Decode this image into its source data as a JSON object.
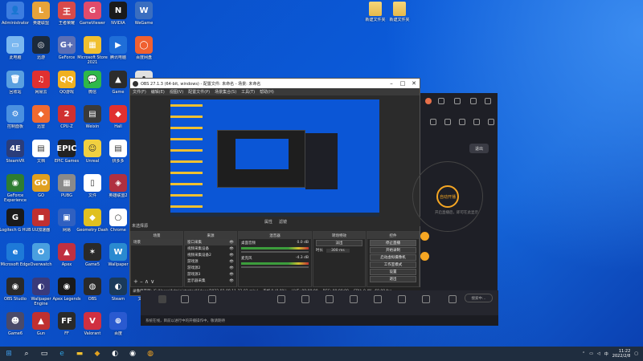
{
  "desktop_icons": [
    {
      "label": "Administrator",
      "color": "#3c7de0",
      "glyph": "👤"
    },
    {
      "label": "英雄联盟",
      "color": "#e8a33a",
      "glyph": "L"
    },
    {
      "label": "王者荣耀",
      "color": "#d84a4a",
      "glyph": "王"
    },
    {
      "label": "GameViewer",
      "color": "#e14b6b",
      "glyph": "G"
    },
    {
      "label": "NVIDIA",
      "color": "#1a1a1a",
      "glyph": "N"
    },
    {
      "label": "WeGame",
      "color": "#3a6ec0",
      "glyph": "W"
    },
    {
      "label": "此电脑",
      "color": "#7ab7f0",
      "glyph": "▭"
    },
    {
      "label": "迅游",
      "color": "#1c2a3b",
      "glyph": "◎"
    },
    {
      "label": "GeForce",
      "color": "#5b6fb5",
      "glyph": "G+"
    },
    {
      "label": "Microsoft Store 2021",
      "color": "#f0c030",
      "glyph": "▦"
    },
    {
      "label": "腾讯电脑",
      "color": "#1f6ed8",
      "glyph": "▶"
    },
    {
      "label": "百度网盘",
      "color": "#f06030",
      "glyph": "◯"
    },
    {
      "label": "回收站",
      "color": "#5aa0e0",
      "glyph": "🗑"
    },
    {
      "label": "网易云",
      "color": "#e03030",
      "glyph": "♫"
    },
    {
      "label": "QQ游戏",
      "color": "#f0b020",
      "glyph": "QQ"
    },
    {
      "label": "微信",
      "color": "#2fb84a",
      "glyph": "💬"
    },
    {
      "label": "Game",
      "color": "#2c2c2c",
      "glyph": "▲"
    },
    {
      "label": "Epic",
      "color": "#e0e0e0",
      "glyph": "A"
    },
    {
      "label": "控制面板",
      "color": "#4a90e0",
      "glyph": "⚙"
    },
    {
      "label": "迅雷",
      "color": "#f06a30",
      "glyph": "◆"
    },
    {
      "label": "CPU-Z",
      "color": "#d03030",
      "glyph": "2"
    },
    {
      "label": "Weixin",
      "color": "#3a3a3a",
      "glyph": "▤"
    },
    {
      "label": "Hall",
      "color": "#e03030",
      "glyph": "◆"
    },
    {
      "label": "Game2",
      "color": "#b02020",
      "glyph": "G"
    },
    {
      "label": "SteamVR",
      "color": "#2b3d7a",
      "glyph": "4E"
    },
    {
      "label": "文档",
      "color": "#ffffff",
      "glyph": "▤"
    },
    {
      "label": "EPIC Games",
      "color": "#222222",
      "glyph": "EPIC"
    },
    {
      "label": "Unreal",
      "color": "#f0d040",
      "glyph": "☺"
    },
    {
      "label": "拼多多",
      "color": "#ffffff",
      "glyph": "▤"
    },
    {
      "label": "Game3",
      "color": "#2a4ab0",
      "glyph": "★"
    },
    {
      "label": "GeForce Experience",
      "color": "#2e7d32",
      "glyph": "◉"
    },
    {
      "label": "GO",
      "color": "#e0a020",
      "glyph": "GO"
    },
    {
      "label": "PUBG",
      "color": "#8a8a8a",
      "glyph": "▦"
    },
    {
      "label": "文件",
      "color": "#ffffff",
      "glyph": "▯"
    },
    {
      "label": "英雄联盟2",
      "color": "#b03040",
      "glyph": "◈"
    },
    {
      "label": "游戏4",
      "color": "#2a3a80",
      "glyph": "⚔"
    },
    {
      "label": "Logitech G HUB",
      "color": "#1a1a1a",
      "glyph": "G"
    },
    {
      "label": "UU加速器",
      "color": "#c03030",
      "glyph": "◼"
    },
    {
      "label": "网易",
      "color": "#3060c0",
      "glyph": "▣"
    },
    {
      "label": "Geometry Dash",
      "color": "#e0c020",
      "glyph": "◆"
    },
    {
      "label": "Chrome",
      "color": "#ffffff",
      "glyph": "○"
    },
    {
      "label": "游戏",
      "color": "#b03030",
      "glyph": "✕"
    },
    {
      "label": "Microsoft Edge",
      "color": "#1e7ad8",
      "glyph": "e"
    },
    {
      "label": "Overwatch",
      "color": "#4aa0e0",
      "glyph": "O"
    },
    {
      "label": "Apex",
      "color": "#c03040",
      "glyph": "▲"
    },
    {
      "label": "Game5",
      "color": "#2a2a2a",
      "glyph": "✶"
    },
    {
      "label": "Wallpaper",
      "color": "#2a8ad0",
      "glyph": "W"
    },
    {
      "label": "Minecraft",
      "color": "#8a5a2a",
      "glyph": "▣"
    },
    {
      "label": "OBS Studio",
      "color": "#2a2a2a",
      "glyph": "◉"
    },
    {
      "label": "Wallpaper Engine",
      "color": "#3a3a7a",
      "glyph": "◐"
    },
    {
      "label": "Apex Legends",
      "color": "#1a1a1a",
      "glyph": "◉"
    },
    {
      "label": "OBS",
      "color": "#2a2a2a",
      "glyph": "◍"
    },
    {
      "label": "Steam",
      "color": "#1a3a5a",
      "glyph": "◐"
    },
    {
      "label": "文件夹",
      "color": "#2a2a2a",
      "glyph": "◈"
    },
    {
      "label": "Game6",
      "color": "#4a4a6a",
      "glyph": "☻"
    },
    {
      "label": "Gun",
      "color": "#c03030",
      "glyph": "▲"
    },
    {
      "label": "FF",
      "color": "#2a2a2a",
      "glyph": "FF"
    },
    {
      "label": "Valorant",
      "color": "#d03040",
      "glyph": "V"
    },
    {
      "label": "百度",
      "color": "#2a5ad0",
      "glyph": "⊕"
    }
  ],
  "folders": [
    {
      "label": "新建文件夹"
    },
    {
      "label": "新建文件夹"
    }
  ],
  "obs": {
    "title": "OBS 27.1.3 (64-bit, windows) - 配置文件: 未命名 - 场景: 未命名",
    "menu": [
      "文件(F)",
      "编辑(E)",
      "视图(V)",
      "配置文件(P)",
      "场景集合(S)",
      "工具(T)",
      "帮助(H)"
    ],
    "source_bar": [
      "属性",
      "滤镜"
    ],
    "no_source": "未选择源",
    "scenes_header": "场景",
    "scenes": [
      "场景"
    ],
    "sources_header": "来源",
    "sources": [
      "窗口采集",
      "视频采集设备",
      "视频采集设备2",
      "游戏源",
      "游戏源2",
      "游戏源3",
      "显示器采集"
    ],
    "mixer_header": "混音器",
    "mixer": [
      {
        "name": "桌面音频",
        "db": "0.0 dB"
      },
      {
        "name": "麦克风",
        "db": "-4.3 dB"
      }
    ],
    "transition_header": "转场特效",
    "transition_value": "淡出",
    "duration_label": "时长",
    "duration_value": "300 ms",
    "controls_header": "控件",
    "controls": [
      "停止直播",
      "开始录制",
      "启动虚拟摄像机",
      "工作室模式",
      "设置",
      "退出"
    ],
    "status": {
      "record_path": "录像保存到: 'C:/Users/Administrator/Videos/2022-02-08 11-22-02.mkv'",
      "drop": "丢帧 0 (0.0%)",
      "live": "LIVE: 00:00:00",
      "rec": "REC: 00:00:00",
      "cpu": "CPU: 0.4%, 60.00 fps"
    }
  },
  "live_app": {
    "logout": "退出",
    "start_live": "自动开播",
    "tip": "开启直播后，即可在此显示"
  },
  "strip": {
    "notice": "系统在线，目前以进行中的开播操作中，敬请期待",
    "search_placeholder": "搜索中…"
  },
  "taskbar": {
    "time": "11:22",
    "date": "2022/2/8",
    "lang": "中"
  }
}
